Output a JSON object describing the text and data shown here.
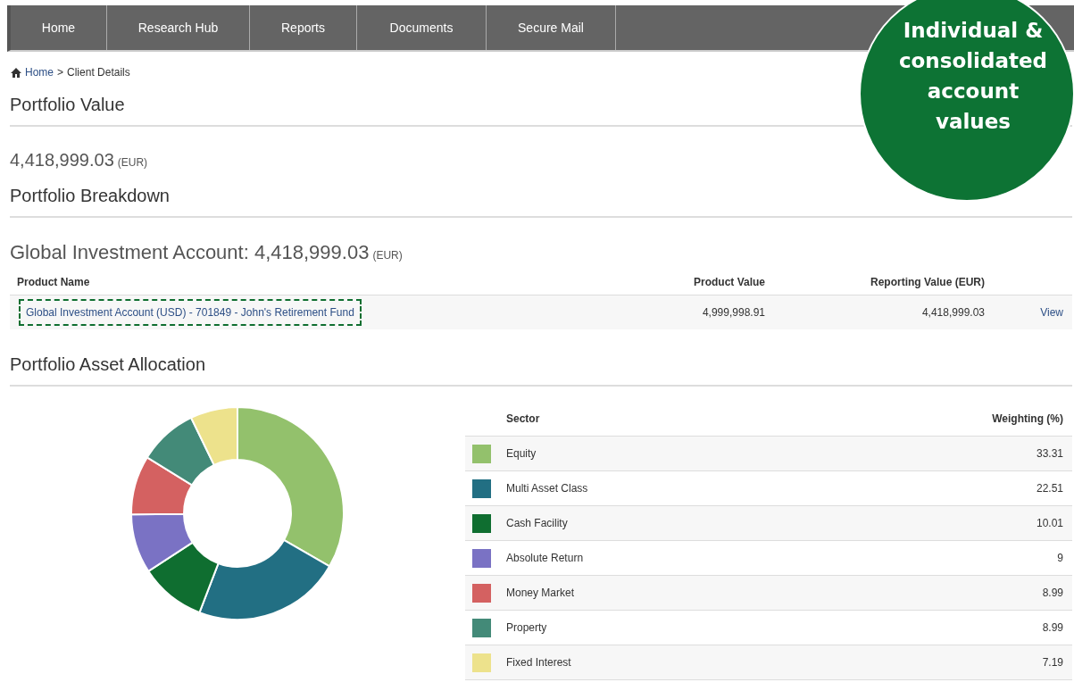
{
  "nav": {
    "items": [
      {
        "label": "Home",
        "selected": false
      },
      {
        "label": "Research Hub",
        "selected": false
      },
      {
        "label": "Reports",
        "selected": false
      },
      {
        "label": "Documents",
        "selected": false
      },
      {
        "label": "Secure Mail",
        "selected": false
      }
    ]
  },
  "callout": {
    "lines": [
      "Individual &",
      "consolidated",
      "account",
      "values"
    ]
  },
  "breadcrumb": {
    "home": "Home",
    "separator": ">",
    "current": "Client Details"
  },
  "portfolio_value": {
    "heading": "Portfolio Value",
    "amount": "4,418,999.03",
    "currency": "(EUR)"
  },
  "portfolio_breakdown": {
    "heading": "Portfolio Breakdown",
    "account_title": "Global Investment Account:",
    "account_amount": "4,418,999.03",
    "account_currency": "(EUR)",
    "columns": [
      "Product Name",
      "Product Value",
      "Reporting Value (EUR)"
    ],
    "rows": [
      {
        "product_name": "Global Investment Account (USD) - 701849 - John's Retirement Fund",
        "highlighted": true,
        "product_value": "4,999,998.91",
        "reporting_value": "4,418,999.03",
        "action": "View"
      }
    ]
  },
  "allocation": {
    "heading": "Portfolio Asset Allocation",
    "sector_header": "Sector",
    "legend": [
      {
        "color": "#93c16c"
      },
      {
        "color": "#226f83"
      },
      {
        "color": "#0f6e30"
      },
      {
        "color": "#7a72c4"
      },
      {
        "color": "#d46161"
      },
      {
        "color": "#438a78"
      },
      {
        "color": "#ede28c"
      }
    ],
    "chart_data": {
      "type": "donut",
      "categories": [
        "Equity",
        "Multi Asset Class",
        "Cash Facility",
        "Absolute Return",
        "Money Market",
        "Property",
        "Fixed Interest"
      ],
      "series": [
        {
          "name": "Weighting (%)",
          "values": [
            33.31,
            22.51,
            10.01,
            9,
            8.99,
            8.99,
            7.19
          ]
        }
      ],
      "value_labels": [
        "33.31",
        "22.51",
        "10.01",
        "9",
        "8.99",
        "8.99",
        "7.19"
      ]
    }
  }
}
